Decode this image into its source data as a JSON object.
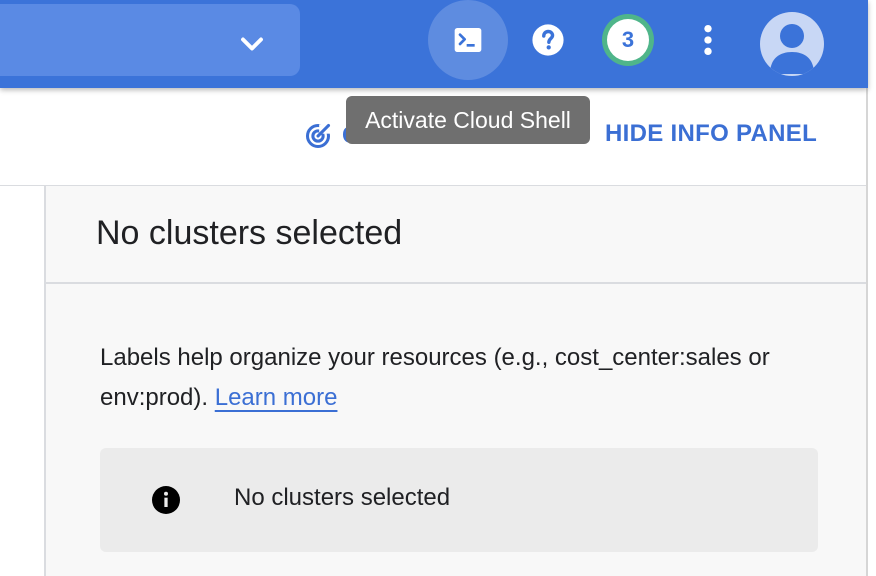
{
  "topbar": {
    "notification_count": "3",
    "colors": {
      "bar": "#3b73d9",
      "badge_ring": "#4fb58a"
    }
  },
  "tooltip": {
    "text": "Activate Cloud Shell"
  },
  "actions": {
    "cost_partial_label": "C",
    "hide_info_panel": "HIDE INFO PANEL"
  },
  "panel": {
    "title": "No clusters selected",
    "labels_text": "Labels help organize your resources (e.g., cost_center:sales or env:prod).",
    "learn_more": "Learn more",
    "notice_text": "No clusters selected"
  },
  "icons": {
    "project_dropdown": "chevron-down-icon",
    "cloud_shell": "terminal-icon",
    "help": "help-icon",
    "more": "more-vert-icon",
    "avatar": "account-icon",
    "cost": "cost-optimization-icon",
    "info": "info-icon"
  }
}
